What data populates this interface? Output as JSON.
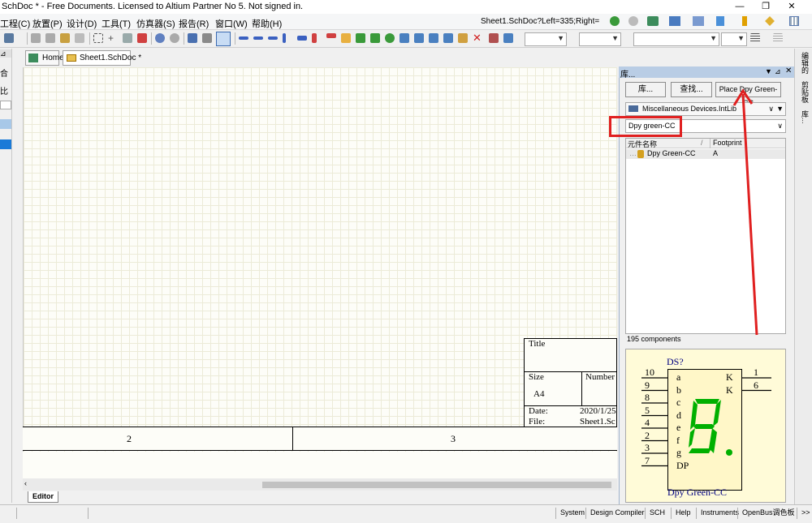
{
  "window": {
    "title": "SchDoc * - Free Documents. Licensed to Altium Partner No 5. Not signed in.",
    "buttons": [
      "—",
      "❐",
      "✕"
    ]
  },
  "menu": {
    "items": [
      "工程(C)",
      "放置(P)",
      "设计(D)",
      "工具(T)",
      "仿真器(S)",
      "报告(R)",
      "窗口(W)",
      "帮助(H)"
    ],
    "location": "Sheet1.SchDoc?Left=335;Right="
  },
  "tabs": {
    "home": "Home",
    "sheet": "Sheet1.SchDoc *"
  },
  "left_strip": {
    "labels": [
      "合",
      "比"
    ]
  },
  "title_block": {
    "title_label": "Title",
    "size_label": "Size",
    "size_value": "A4",
    "number_label": "Number",
    "date_label": "Date:",
    "date_value": "2020/1/25",
    "file_label": "File:",
    "file_value": "Sheet1.Sc"
  },
  "zones": [
    "2",
    "3"
  ],
  "editor_tab": "Editor",
  "panel": {
    "title": "库...",
    "lib_button": "库...",
    "search_button": "查找...",
    "place_button": "Place Dpy Green-CC",
    "library": "Miscellaneous Devices.IntLib",
    "filter_value": "Dpy green-CC",
    "col_name": "元件名称",
    "col_footprint": "Footprint",
    "component_name": "Dpy Green-CC",
    "component_footprint": "A",
    "count": "195 components"
  },
  "preview": {
    "designator": "DS?",
    "component": "Dpy Green-CC",
    "left_pins": [
      "10",
      "9",
      "8",
      "5",
      "4",
      "2",
      "3",
      "7"
    ],
    "left_labels": [
      "a",
      "b",
      "c",
      "d",
      "e",
      "f",
      "g",
      "DP"
    ],
    "right_pins": [
      "1",
      "6"
    ],
    "right_labels": [
      "K",
      "K"
    ],
    "digit_color": "#00b000"
  },
  "status": {
    "items": [
      "System",
      "Design Compiler",
      "SCH",
      "Help",
      "Instruments",
      "OpenBus调色板",
      ">>"
    ]
  },
  "right_dock": {
    "labels": [
      "编辑的",
      "剪贴板",
      "库..."
    ]
  },
  "colors": {
    "highlight": "#e02020",
    "panel_header": "#b9cde5",
    "canvas": "#fdfdf8"
  }
}
